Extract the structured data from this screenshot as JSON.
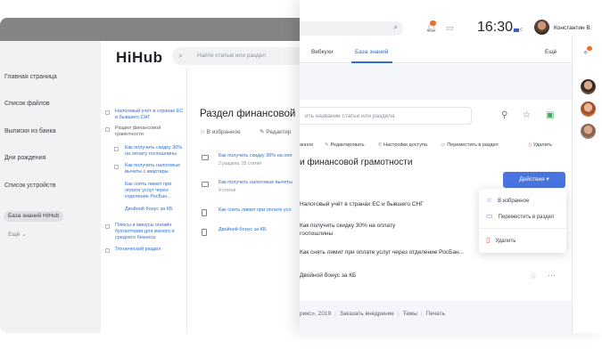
{
  "back": {
    "sidebar": {
      "items": [
        "Главная страница",
        "Список файлов",
        "Выписки из банка",
        "Дни рождения",
        "Список устройств"
      ],
      "active": "База знаний HiHub",
      "more": "Ещё"
    },
    "logo": "HiHub",
    "search_placeholder": "Найти статью или раздел",
    "tree": [
      "Налоговый учёт в странах ЕС и бывшего СНГ",
      "Раздел финансовой грамотности",
      "Как получить скидку 30% на оплату госпошлины",
      "Как получить налоговые вычеты с квартиры",
      "Как снять лимит при оплате услуг через отделение РосБан...",
      "Двойной бонус за КБ",
      "Плюсы и минусы онлайн бухгалтерии для малого и среднего бизнеса",
      "Технический раздел"
    ],
    "section_title": "Раздел финансовой",
    "actions": {
      "favorite": "В избранное",
      "edit": "Редактир"
    },
    "files": [
      {
        "title": "Как получить скидку 30% на опл",
        "sub": "2 раздела, 35 статей"
      },
      {
        "title": "Как получить налоговые вычеты",
        "sub": "4 статьи"
      },
      {
        "title": "Как снять лимит при оплате усл",
        "sub": ""
      },
      {
        "title": "Двойной бонус за КБ",
        "sub": ""
      }
    ]
  },
  "front": {
    "header": {
      "clock": "16:30",
      "lang": "€",
      "user_name": "Константин В."
    },
    "tabs": [
      "Вебкухи",
      "База знаний"
    ],
    "tabs_more": "Ещё",
    "search_placeholder": "ить название статьи или раздела",
    "toolbar": [
      "анное",
      "Редактировать",
      "Настройки доступа",
      "Переместить в раздел",
      "Удалить"
    ],
    "title": "и финансовой грамотности",
    "actions_button": "Действия ▾",
    "rows": [
      "Налоговый учёт в странах ЕС и бывшего СНГ",
      "Как получить скидку 30% на оплату госпошлины",
      "Как снять лимит при оплате услуг через отделение РосБан...",
      "Двойной бонус за КБ"
    ],
    "dropdown": [
      "В избранное",
      "Переместить в раздел",
      "Удалить"
    ],
    "footer": [
      "рикс», 2019",
      "Заказать внедрение",
      "Темы",
      "Печать"
    ]
  },
  "colors": {
    "accent": "#4a74e0",
    "link": "#2d6fd6",
    "danger": "#e0524a",
    "badge": "#f06a2a"
  }
}
